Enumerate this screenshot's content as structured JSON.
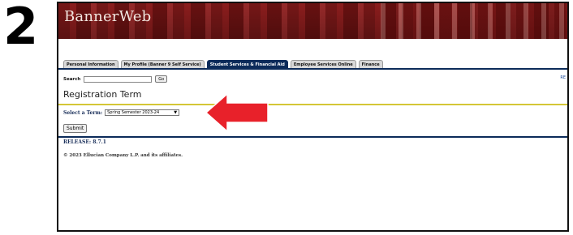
{
  "step_number": "2",
  "banner": {
    "title": "BannerWeb"
  },
  "tabs": [
    {
      "label": "Personal Information",
      "active": false
    },
    {
      "label": "My Profile (Banner 9 Self Service)",
      "active": false
    },
    {
      "label": "Student Services & Financial Aid",
      "active": true
    },
    {
      "label": "Employee Services Online",
      "active": false
    },
    {
      "label": "Finance",
      "active": false
    }
  ],
  "search": {
    "label": "Search",
    "value": "",
    "go_label": "Go"
  },
  "corner_link": "RE",
  "page_title": "Registration Term",
  "term": {
    "label": "Select a Term:",
    "selected": "Spring Semester 2023-24"
  },
  "submit_label": "Submit",
  "release": "RELEASE: 8.7.1",
  "copyright": "© 2023 Ellucian Company L.P. and its affiliates.",
  "annotation": {
    "arrow_color": "#e8212a"
  }
}
